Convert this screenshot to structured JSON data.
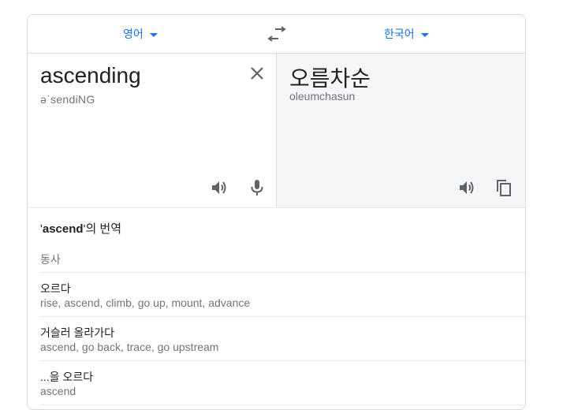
{
  "langbar": {
    "source_lang": "영어",
    "target_lang": "한국어",
    "swap_icon": "swap-icon"
  },
  "source": {
    "text": "ascending",
    "pronunciation": "əˈsendiNG",
    "icons": [
      "close-icon",
      "speaker-icon",
      "microphone-icon"
    ]
  },
  "target": {
    "text": "오름차순",
    "romanization": "oleumchasun",
    "icons": [
      "speaker-icon",
      "copy-icon"
    ]
  },
  "dictionary": {
    "title_pre": "'",
    "title_word": "ascend",
    "title_post": "'의 번역",
    "pos": "동사",
    "entries": [
      {
        "word": "오르다",
        "synonyms": "rise, ascend, climb, go up, mount, advance"
      },
      {
        "word": "거슬러 올라가다",
        "synonyms": "ascend, go back, trace, go upstream"
      },
      {
        "word": "...을 오르다",
        "synonyms": "ascend"
      }
    ]
  },
  "colors": {
    "accent": "#1a73e8",
    "target_bg": "#f5f6f8",
    "icon": "#5f6368"
  }
}
